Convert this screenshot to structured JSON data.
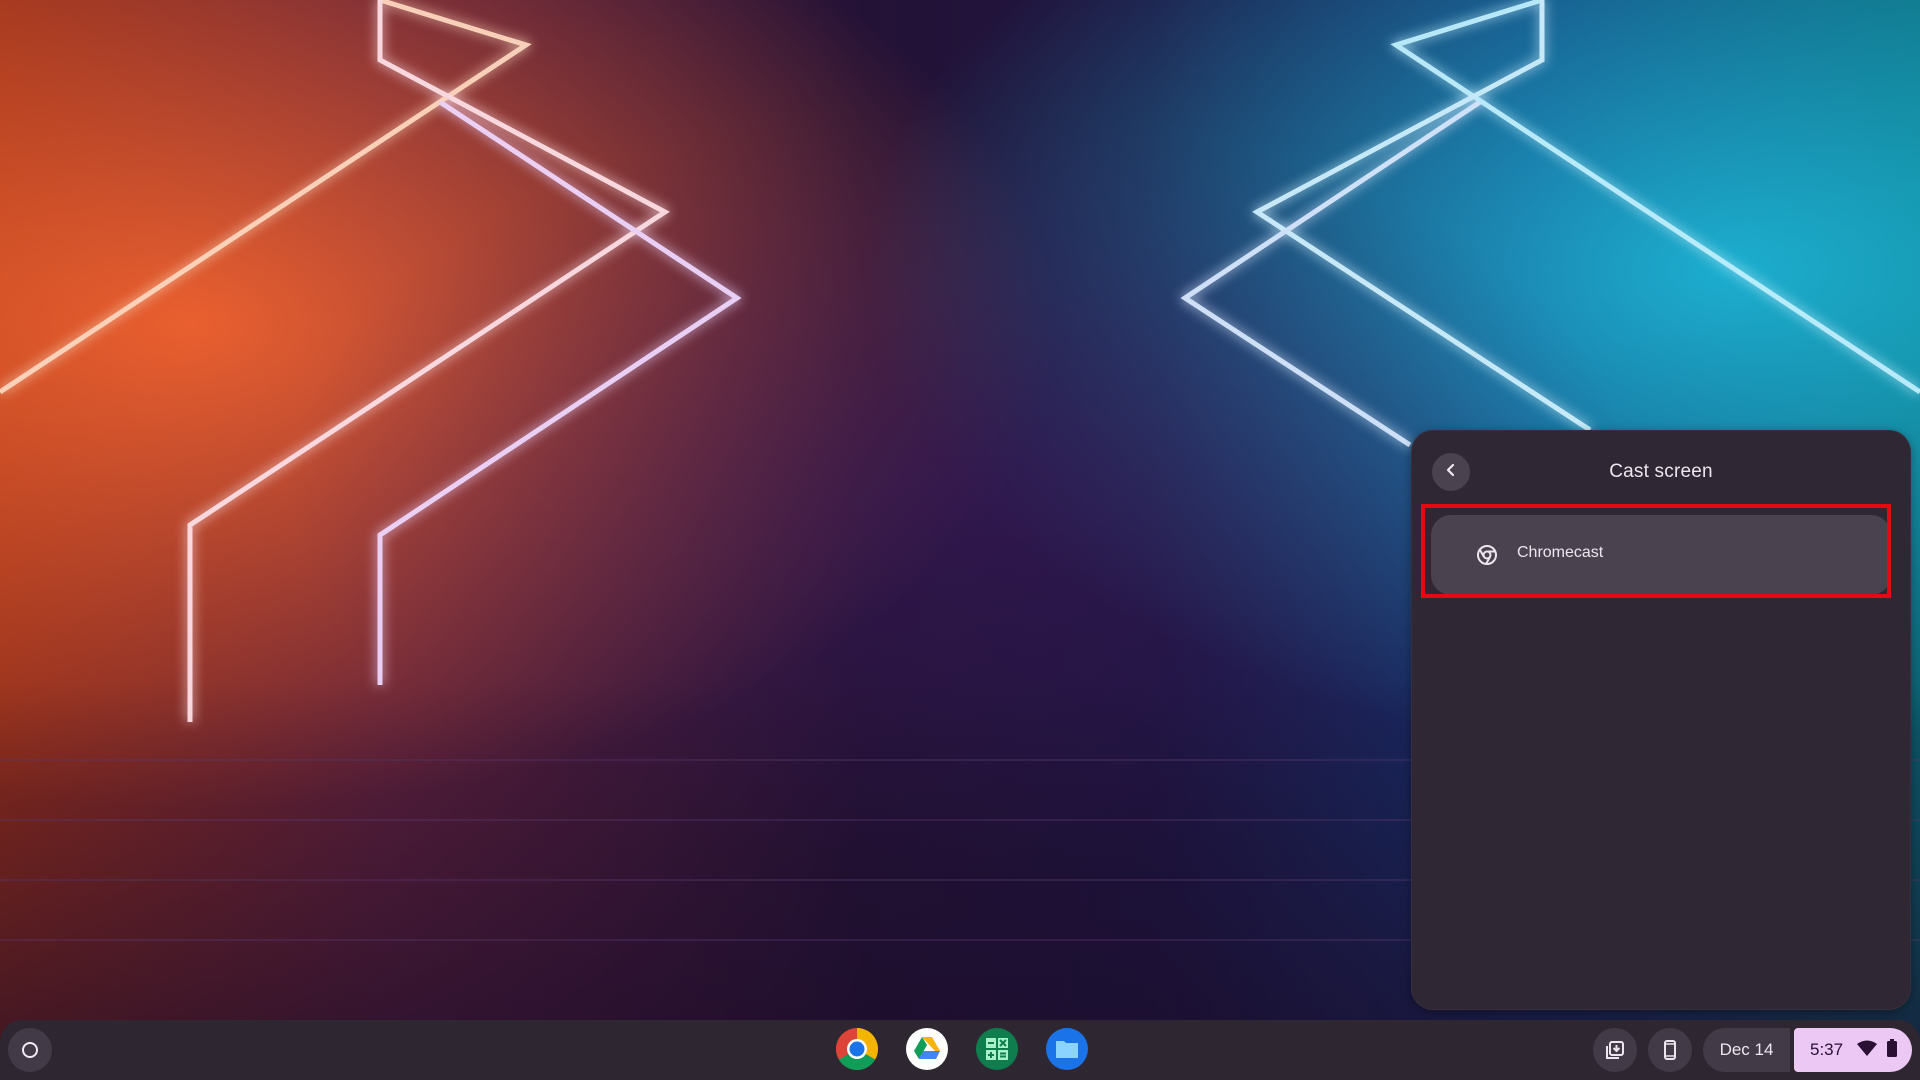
{
  "wallpaper": {
    "description": "neon chevron corridor",
    "colors": {
      "left": "#e8502a",
      "center": "#2a1440",
      "right": "#15b8d8",
      "accent_purple": "#8a4cf0"
    }
  },
  "cast_panel": {
    "title": "Cast screen",
    "back_icon": "chevron-left-icon",
    "devices": [
      {
        "label": "Chromecast",
        "icon": "chromecast-chrome-icon",
        "highlighted": true
      }
    ],
    "highlight_color": "#e50914"
  },
  "shelf": {
    "launcher_icon": "launcher-circle-icon",
    "apps": [
      {
        "name": "Chrome",
        "icon": "chrome-icon"
      },
      {
        "name": "Google Drive",
        "icon": "drive-icon"
      },
      {
        "name": "Calculator",
        "icon": "calculator-icon"
      },
      {
        "name": "Files",
        "icon": "files-icon"
      }
    ],
    "tray": {
      "holding_space_icon": "holding-space-icon",
      "phone_hub_icon": "phone-icon",
      "date": "Dec 14",
      "time": "5:37",
      "wifi_icon": "wifi-icon",
      "battery_icon": "battery-icon",
      "status_color": "#ecc8f5"
    }
  }
}
